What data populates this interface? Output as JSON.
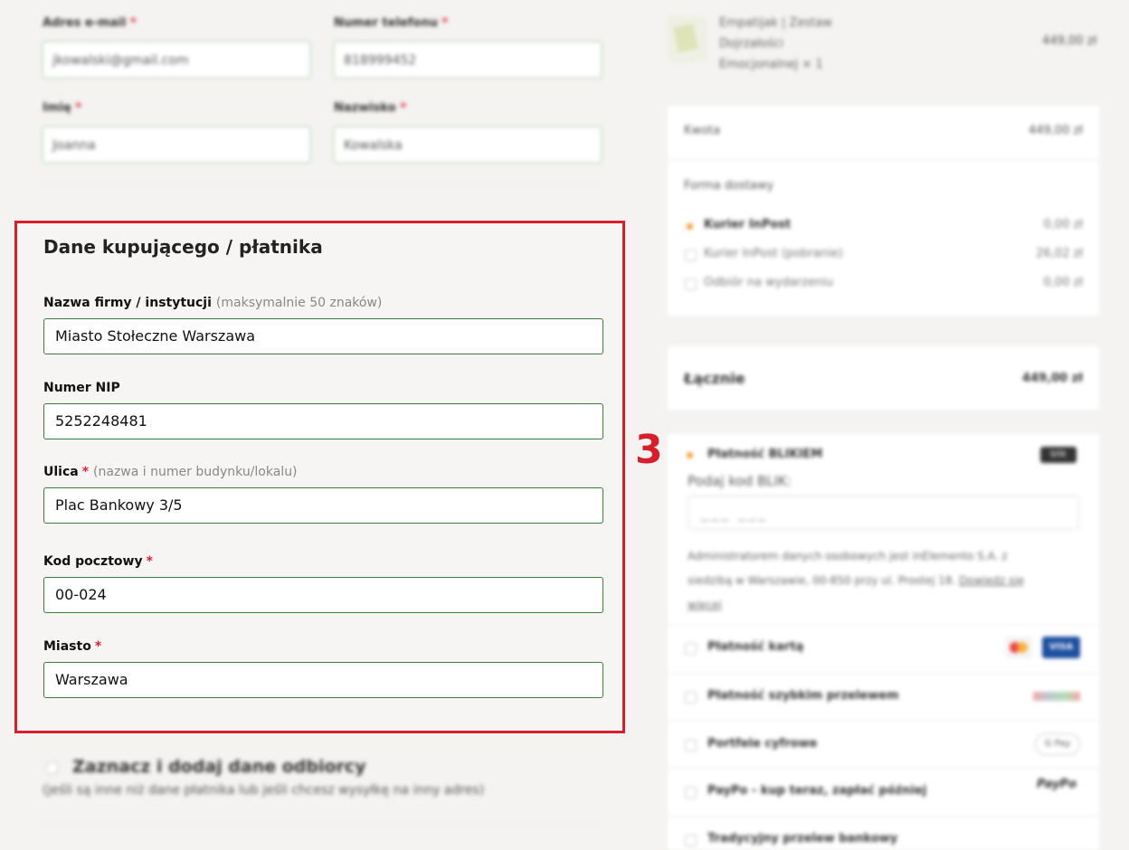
{
  "contact": {
    "email_label": "Adres e-mail",
    "email_value": "jkowalski@gmail.com",
    "phone_label": "Numer telefonu",
    "phone_value": "818999452",
    "first_name_label": "Imię",
    "first_name_value": "Joanna",
    "last_name_label": "Nazwisko",
    "last_name_value": "Kowalska",
    "required_mark": "*"
  },
  "buyer": {
    "title": "Dane kupującego / płatnika",
    "company_label": "Nazwa firmy / instytucji",
    "company_hint": "(maksymalnie 50 znaków)",
    "company_value": "Miasto Stołeczne Warszawa",
    "nip_label": "Numer NIP",
    "nip_value": "5252248481",
    "street_label": "Ulica",
    "street_hint": "(nazwa i numer budynku/lokalu)",
    "street_value": "Plac Bankowy 3/5",
    "postal_label": "Kod pocztowy",
    "postal_value": "00-024",
    "city_label": "Miasto",
    "city_value": "Warszawa",
    "required_mark": "*"
  },
  "annotation": {
    "step_number": "3",
    "color": "#d81e2b"
  },
  "recipient": {
    "checkbox_label": "Zaznacz i dodaj dane odbiorcy",
    "checkbox_hint": "(jeśli są inne niż dane płatnika lub jeśli chcesz wysyłkę na inny adres)"
  },
  "summary": {
    "product_name_lines": [
      "Empatijak | Zestaw",
      "Dojrzałości",
      "Emocjonalnej  × 1"
    ],
    "product_price": "449,00 zł",
    "amount_label": "Kwota",
    "amount_value": "449,00 zł",
    "delivery_label": "Forma dostawy",
    "delivery_options": [
      {
        "label": "Kurier InPost",
        "price": "0,00 zł",
        "selected": true
      },
      {
        "label": "Kurier InPost (pobranie)",
        "price": "26,02 zł",
        "selected": false
      },
      {
        "label": "Odbiór na wydarzeniu",
        "price": "0,00 zł",
        "selected": false
      }
    ],
    "total_label": "Łącznie",
    "total_value": "449,00 zł"
  },
  "payment": {
    "blik_label": "Płatność BLIKIEM",
    "blik_badge": "blik",
    "blik_code_label": "Podaj kod BLIK:",
    "blik_code_placeholder": "___ ___",
    "privacy_text": "Administratorem danych osobowych jest inElemento S.A. z siedzibą w Warszawie, 00-850 przy ul. Prostej 18.",
    "privacy_link": "Dowiedz się więcej",
    "methods": [
      {
        "label": "Płatność kartą",
        "badge": "VISA"
      },
      {
        "label": "Płatność szybkim przelewem",
        "badge": ""
      },
      {
        "label": "Portfele cyfrowe",
        "badge": "G Pay"
      },
      {
        "label": "PayPo - kup teraz, zapłać później",
        "badge": "PayPo"
      },
      {
        "label": "Tradycyjny przelew bankowy",
        "badge": ""
      }
    ]
  }
}
